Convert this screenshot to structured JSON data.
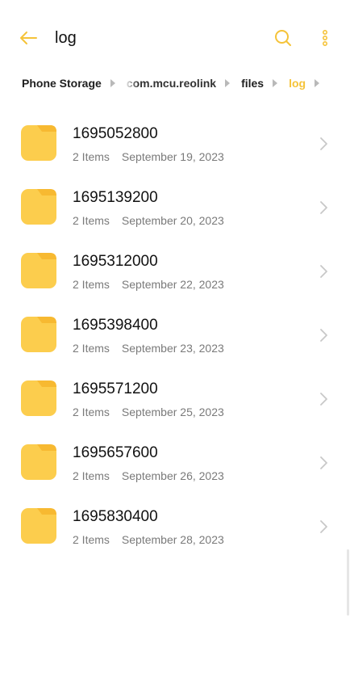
{
  "header": {
    "title": "log",
    "accent_color": "#f5c339"
  },
  "breadcrumb": [
    {
      "label": "Phone Storage",
      "state": "normal"
    },
    {
      "label": "com.mcu.reolink",
      "state": "faded"
    },
    {
      "label": "files",
      "state": "normal"
    },
    {
      "label": "log",
      "state": "active"
    }
  ],
  "folders": [
    {
      "name": "1695052800",
      "items": "2 Items",
      "date": "September 19, 2023"
    },
    {
      "name": "1695139200",
      "items": "2 Items",
      "date": "September 20, 2023"
    },
    {
      "name": "1695312000",
      "items": "2 Items",
      "date": "September 22, 2023"
    },
    {
      "name": "1695398400",
      "items": "2 Items",
      "date": "September 23, 2023"
    },
    {
      "name": "1695571200",
      "items": "2 Items",
      "date": "September 25, 2023"
    },
    {
      "name": "1695657600",
      "items": "2 Items",
      "date": "September 26, 2023"
    },
    {
      "name": "1695830400",
      "items": "2 Items",
      "date": "September 28, 2023"
    }
  ],
  "icons": {
    "back": "arrow-left-icon",
    "search": "search-icon",
    "more": "more-vertical-icon",
    "folder": "folder-icon",
    "chevron": "chevron-right-icon"
  },
  "colors": {
    "folder": "#fccd4d",
    "folder_tab": "#f7b931",
    "chevron": "#c8c8c8"
  }
}
